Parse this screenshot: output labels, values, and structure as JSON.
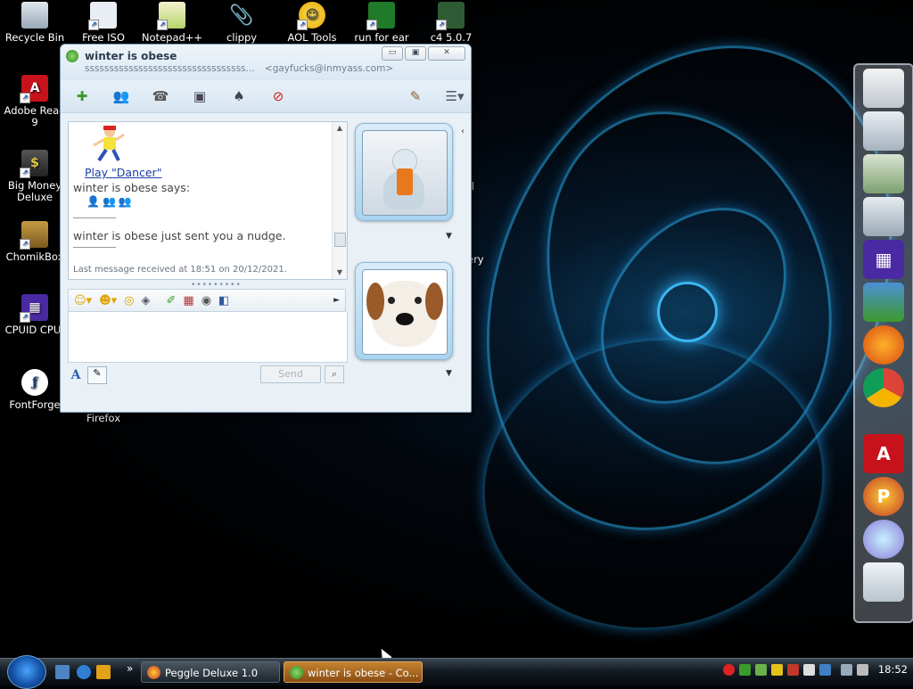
{
  "desktop": {
    "icons": [
      {
        "label": "Recycle Bin"
      },
      {
        "label": "Free ISO"
      },
      {
        "label": "Notepad++"
      },
      {
        "label": "clippy"
      },
      {
        "label": "AOL Tools"
      },
      {
        "label": "run for ear"
      },
      {
        "label": "c4 5.0.7"
      },
      {
        "label": "Adobe Read 9"
      },
      {
        "label": "Big Money Deluxe"
      },
      {
        "label": "ChomikBox"
      },
      {
        "label": "CPUID CPU-"
      },
      {
        "label": "FontForge"
      },
      {
        "label": "Firefox"
      },
      {
        "label": "cull"
      },
      {
        "label": "ery"
      }
    ]
  },
  "messenger": {
    "title": "winter is obese",
    "subtitle_status": "sssssssssssssssssssssssssssssssss...",
    "subtitle_email": "<gayfucks@inmyass.com>",
    "window_buttons": {
      "minimize": "▭",
      "maximize": "▣",
      "close": "✕"
    },
    "toolbar_icons": [
      "invite-contact-icon",
      "share-folder-icon",
      "call-icon",
      "video-icon",
      "games-icon",
      "block-icon",
      "paintbrush-icon",
      "menu-icon"
    ],
    "history": {
      "play_link": "Play \"Dancer\"",
      "says": "winter is obese says:",
      "nudge": "winter is obese just sent you a nudge.",
      "last_message": "Last message received at 18:51 on 20/12/2021."
    },
    "grip": "•••••••••",
    "send_label": "Send"
  },
  "taskbar": {
    "buttons": [
      {
        "label": "Peggle Deluxe 1.0"
      },
      {
        "label": "winter is obese - Co..."
      }
    ],
    "clock": "18:52",
    "quicklaunch_chevron": "»"
  }
}
